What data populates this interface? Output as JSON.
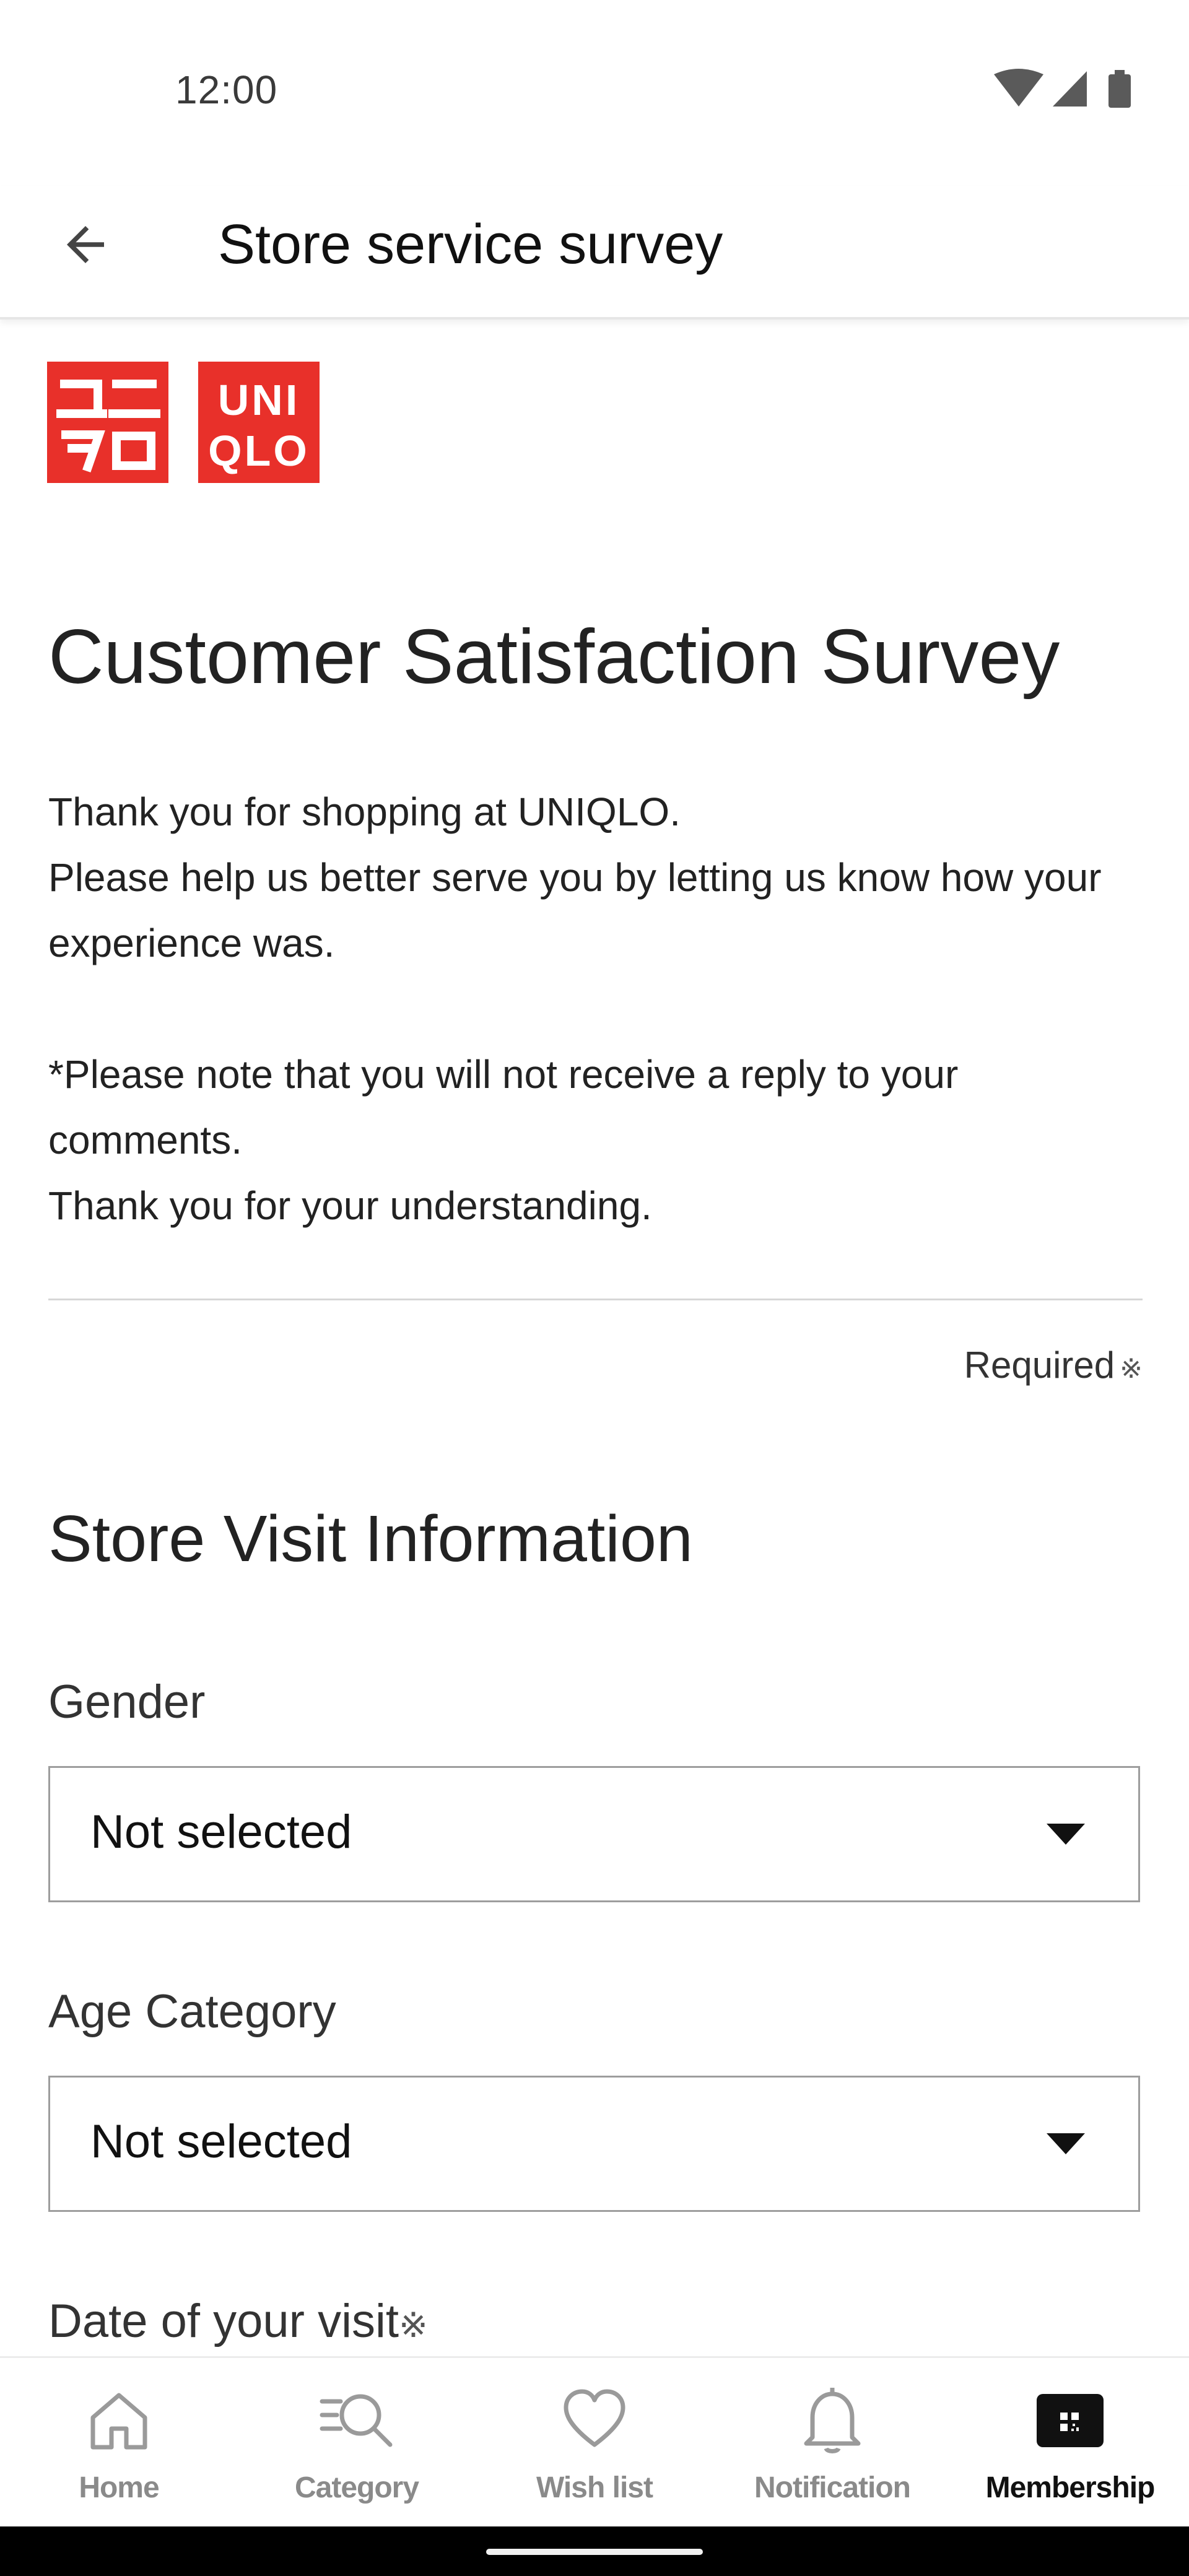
{
  "status_bar": {
    "time": "12:00",
    "icons": [
      "wifi-icon",
      "cellular-signal-icon",
      "battery-icon"
    ]
  },
  "app_bar": {
    "back_icon": "arrow-left-icon",
    "title": "Store service survey"
  },
  "brand": {
    "name": "UNIQLO",
    "logo_text_left": "ユニクロ",
    "logo_text_right": "UNIQLO",
    "color": "#e8302a"
  },
  "survey": {
    "heading": "Customer Satisfaction Survey",
    "intro_lines": [
      "Thank you for shopping at UNIQLO.",
      "Please help us better serve you by letting us know how your experience was."
    ],
    "note_lines": [
      "*Please note that you will not receive a reply to your comments.",
      "Thank you for your understanding."
    ],
    "required_label": "Required",
    "required_mark": "※",
    "section_title": "Store Visit Information",
    "fields": [
      {
        "label": "Gender",
        "value": "Not selected"
      },
      {
        "label": "Age Category",
        "value": "Not selected"
      },
      {
        "label": "Date of your visit",
        "required_mark": "※"
      }
    ]
  },
  "bottom_nav": {
    "items": [
      {
        "label": "Home",
        "icon": "home-icon",
        "active": false
      },
      {
        "label": "Category",
        "icon": "category-search-icon",
        "active": false
      },
      {
        "label": "Wish list",
        "icon": "heart-icon",
        "active": false
      },
      {
        "label": "Notification",
        "icon": "bell-icon",
        "active": false
      },
      {
        "label": "Membership",
        "icon": "membership-card-icon",
        "active": true
      }
    ]
  },
  "colors": {
    "text": "#1b1b1b",
    "inactive_nav": "#8a8a8a",
    "active_nav": "#111111",
    "border": "#9d9d9d"
  }
}
